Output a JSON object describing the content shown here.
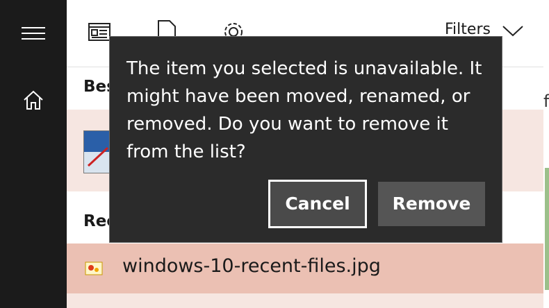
{
  "dialog": {
    "message": "The item you selected is unavailable. It might have been moved, renamed, or removed. Do you want to remove it from the list?",
    "cancel_label": "Cancel",
    "remove_label": "Remove"
  },
  "toolbar": {
    "filters_label": "Filters"
  },
  "results": {
    "best_match_label": "Bes",
    "recent_label": "Rec",
    "recent_file": "windows-10-recent-files.jpg"
  },
  "right_edge": {
    "partial_text": "f"
  },
  "colors": {
    "sidebar_bg": "#1b1b1b",
    "dialog_bg": "#2b2b2b",
    "selected_row": "#ebc0b3",
    "best_row": "#f6e6e1"
  },
  "icons": {
    "menu": "hamburger-icon",
    "home": "home-icon",
    "apps": "apps-icon",
    "documents": "document-icon",
    "settings": "gear-icon",
    "filters": "chevron-down-icon"
  }
}
